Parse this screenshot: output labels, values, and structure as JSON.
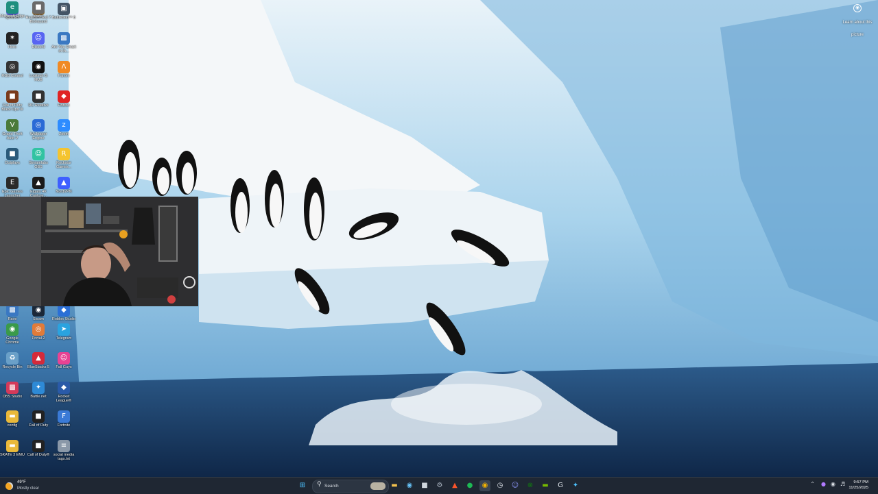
{
  "desktop": {
    "icons": [
      {
        "name": "spotlify-icon",
        "label": "spotiflex",
        "glyph": "☰",
        "color": "#5b5fd6"
      },
      {
        "name": "game-icon-1",
        "label": "Resident Evil 7 Biohazard",
        "glyph": "✹",
        "color": "#8a6a3a"
      },
      {
        "name": "game-icon-2",
        "label": "Battlefield™ 6",
        "glyph": "▣",
        "color": "#445566"
      },
      {
        "name": "game-icon-3",
        "label": "Hero",
        "glyph": "✶",
        "color": "#222222"
      },
      {
        "name": "discord-icon",
        "label": "Discord",
        "glyph": "☺",
        "color": "#5865f2"
      },
      {
        "name": "game-icon-4",
        "label": "Are You Smart in th...",
        "glyph": "▩",
        "color": "#3a78c2"
      },
      {
        "name": "rgb-icon",
        "label": "RGB Control",
        "glyph": "◎",
        "color": "#333333"
      },
      {
        "name": "logitech-icon",
        "label": "Logitech G HUB",
        "glyph": "◉",
        "color": "#111111"
      },
      {
        "name": "parsec-icon",
        "label": "Parsec",
        "glyph": "Λ",
        "color": "#f08a24"
      },
      {
        "name": "cod-icon-1",
        "label": "Call of Duty Black Ops III",
        "glyph": "■",
        "color": "#7a3a1a"
      },
      {
        "name": "game-icon-5",
        "label": "DC Relative",
        "glyph": "■",
        "color": "#333333"
      },
      {
        "name": "roblox-icon",
        "label": "Roblox",
        "glyph": "◆",
        "color": "#e02424"
      },
      {
        "name": "gta-icon",
        "label": "Grand Theft Auto V",
        "glyph": "V",
        "color": "#4a7a3a"
      },
      {
        "name": "wallpaper-engine-icon",
        "label": "Wallpaper Engine",
        "glyph": "◎",
        "color": "#2a6ad6"
      },
      {
        "name": "zoom-icon",
        "label": "Zoom",
        "glyph": "z",
        "color": "#2d8cff"
      },
      {
        "name": "game-icon-6",
        "label": "Outplays",
        "glyph": "■",
        "color": "#2a5a7a"
      },
      {
        "name": "streamlabs-icon",
        "label": "Streamlabs OBS",
        "glyph": "☺",
        "color": "#31c3a2"
      },
      {
        "name": "rockstar-icon",
        "label": "Rockstar Games...",
        "glyph": "R",
        "color": "#f4c430"
      },
      {
        "name": "epic-icon",
        "label": "Epic Games Launcher",
        "glyph": "E",
        "color": "#2a2a2a"
      },
      {
        "name": "elgato-icon",
        "label": "Elgato 4K Capture...",
        "glyph": "▲",
        "color": "#1a1a1a"
      },
      {
        "name": "nordvpn-icon",
        "label": "NordVPN",
        "glyph": "▲",
        "color": "#3e5fff"
      },
      {
        "name": "game-icon-7",
        "label": "Rave",
        "glyph": "▩",
        "color": "#3a78c2"
      },
      {
        "name": "steam-icon-1",
        "label": "Steam",
        "glyph": "◉",
        "color": "#1b2838"
      },
      {
        "name": "roblox-studio-icon",
        "label": "Roblox Studio",
        "glyph": "◆",
        "color": "#2b6fd6"
      },
      {
        "name": "chrome-icon",
        "label": "Google Chrome",
        "glyph": "◉",
        "color": "#3a9a4a"
      },
      {
        "name": "portal-icon",
        "label": "Portal 2",
        "glyph": "◎",
        "color": "#e07b39"
      },
      {
        "name": "telegram-icon",
        "label": "Telegram",
        "glyph": "➤",
        "color": "#2aa3df"
      },
      {
        "name": "recycle-bin-icon",
        "label": "Recycle Bin",
        "glyph": "♻",
        "color": "#6aa0c8"
      },
      {
        "name": "bluestacks-icon",
        "label": "BlueStacks 5",
        "glyph": "▲",
        "color": "#d42a3a"
      },
      {
        "name": "fall-guys-icon",
        "label": "Fall Guys",
        "glyph": "☺",
        "color": "#e84393"
      },
      {
        "name": "game-icon-8",
        "label": "OBS Studio",
        "glyph": "▩",
        "color": "#d43a5a"
      },
      {
        "name": "battlenet-icon",
        "label": "Battle.net",
        "glyph": "✦",
        "color": "#2e8ad6"
      },
      {
        "name": "rocket-league-icon",
        "label": "Rocket League®",
        "glyph": "◆",
        "color": "#2a5aa8"
      },
      {
        "name": "folder-icon-1",
        "label": "config",
        "glyph": "▬",
        "color": "#e9b93a"
      },
      {
        "name": "cod-icon-2",
        "label": "Call of Duty",
        "glyph": "■",
        "color": "#222222"
      },
      {
        "name": "fortnite-icon",
        "label": "Fortnite",
        "glyph": "F",
        "color": "#3a7ad6"
      },
      {
        "name": "folder-icon-2",
        "label": "SKATE 3 EMU",
        "glyph": "▬",
        "color": "#e9b93a"
      },
      {
        "name": "cod-icon-3",
        "label": "Call of Duty®",
        "glyph": "■",
        "color": "#222222"
      },
      {
        "name": "text-file-icon",
        "label": "social media tags.txt",
        "glyph": "≡",
        "color": "#8a98a8"
      },
      {
        "name": "edge-icon",
        "label": "Microsoft Edge",
        "glyph": "e",
        "color": "#1e8e7e"
      },
      {
        "name": "skate-icon",
        "label": "skate.",
        "glyph": "■",
        "color": "#6a6a6a"
      }
    ],
    "learn_more": "Learn about this picture"
  },
  "taskbar": {
    "weather_temp": "49°F",
    "weather_desc": "Mostly clear",
    "search_placeholder": "Search",
    "apps": [
      {
        "name": "start-icon",
        "glyph": "⊞",
        "color": "#4cc2ff"
      },
      {
        "name": "file-explorer-icon",
        "glyph": "▬",
        "color": "#f2c14e"
      },
      {
        "name": "steam-taskbar-icon",
        "glyph": "◉",
        "color": "#66c0f4"
      },
      {
        "name": "terminal-icon",
        "glyph": "■",
        "color": "#cfd6de"
      },
      {
        "name": "settings-icon",
        "glyph": "⚙",
        "color": "#aab4c0"
      },
      {
        "name": "brave-icon",
        "glyph": "▲",
        "color": "#fb542b"
      },
      {
        "name": "spotify-icon",
        "glyph": "●",
        "color": "#1db954"
      },
      {
        "name": "chrome-taskbar-icon",
        "glyph": "◉",
        "color": "#f4b400"
      },
      {
        "name": "clock-app-icon",
        "glyph": "◷",
        "color": "#dde2e8"
      },
      {
        "name": "discord-taskbar-icon",
        "glyph": "☺",
        "color": "#8b95f7"
      },
      {
        "name": "xbox-icon",
        "glyph": "⊗",
        "color": "#107c10"
      },
      {
        "name": "nvidia-icon",
        "glyph": "▬",
        "color": "#76b900"
      },
      {
        "name": "ghub-icon",
        "glyph": "G",
        "color": "#dde2e8"
      },
      {
        "name": "copilot-icon",
        "glyph": "✦",
        "color": "#4cc2ff"
      }
    ],
    "time": "9:57 PM",
    "date": "11/25/2025"
  }
}
